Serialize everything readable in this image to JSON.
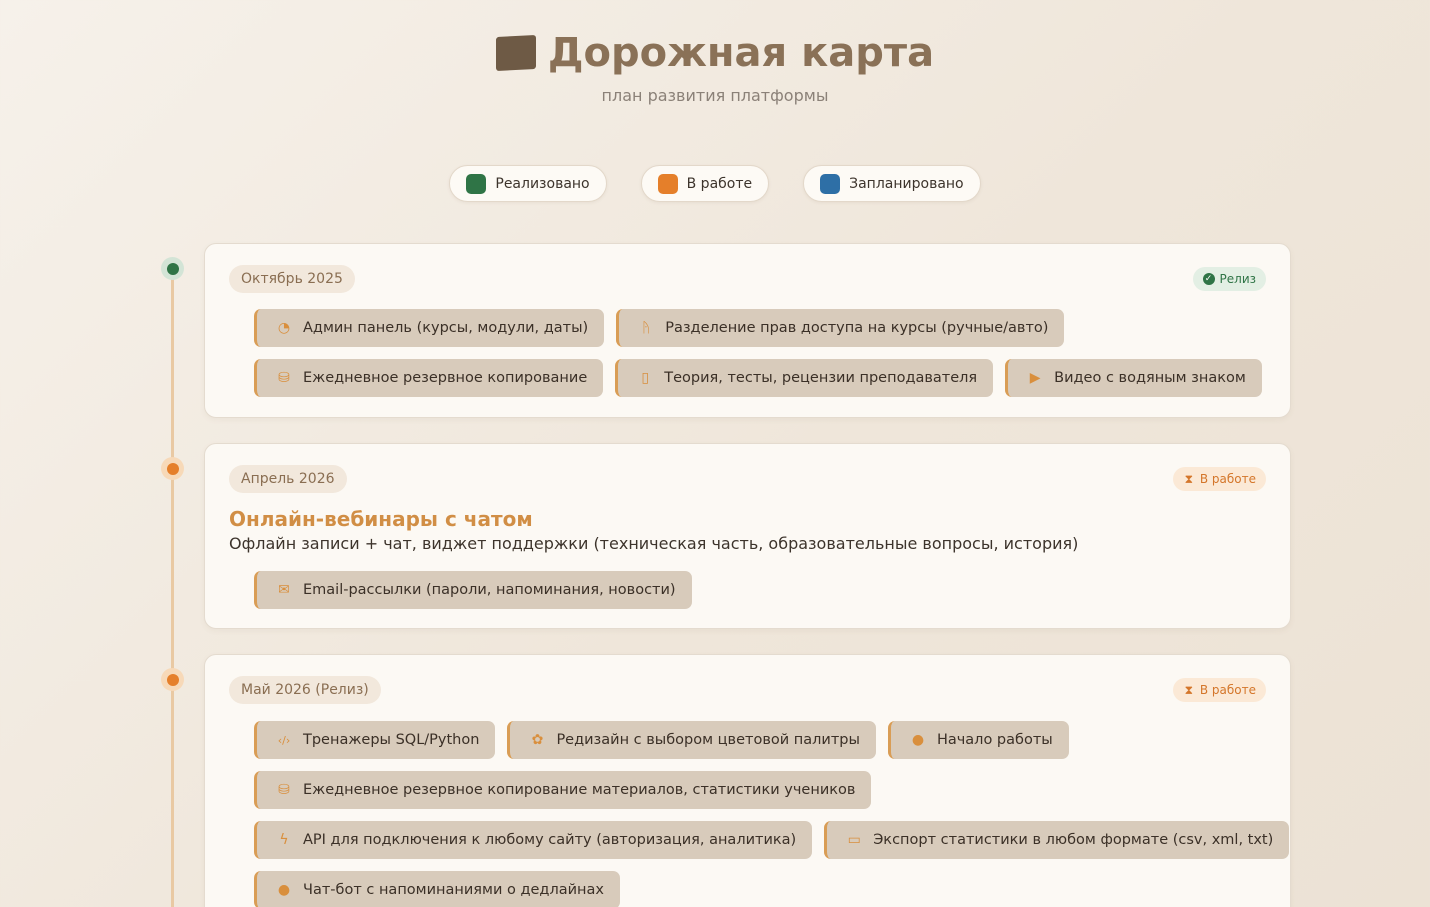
{
  "header": {
    "title": "Дорожная карта",
    "subtitle": "план развития платформы",
    "title_icon": "map-icon"
  },
  "legend": [
    {
      "label": "Реализовано",
      "color": "#2f7446"
    },
    {
      "label": "В работе",
      "color": "#e57f2a"
    },
    {
      "label": "Запланировано",
      "color": "#2e6fa6"
    }
  ],
  "milestones": [
    {
      "date": "Октябрь 2025",
      "status": "Релиз",
      "status_type": "done",
      "rows": [
        [
          {
            "icon": "dashboard-icon",
            "glyph": "◔",
            "label": "Админ панель (курсы, модули, даты)"
          },
          {
            "icon": "person-icon",
            "glyph": "ᚤ",
            "label": "Разделение прав доступа на курсы (ручные/авто)"
          }
        ],
        [
          {
            "icon": "database-icon",
            "glyph": "⛁",
            "label": "Ежедневное резервное копирование"
          },
          {
            "icon": "book-icon",
            "glyph": "▯",
            "label": "Теория, тесты, рецензии преподавателя"
          },
          {
            "icon": "video-icon",
            "glyph": "▶",
            "label": "Видео с водяным знаком"
          }
        ]
      ]
    },
    {
      "date": "Апрель 2026",
      "status": "В работе",
      "status_type": "work",
      "title": "Онлайн-вебинары с чатом",
      "description": "Офлайн записи + чат, виджет поддержки (техническая часть, образовательные вопросы, история)",
      "rows": [
        [
          {
            "icon": "mail-icon",
            "glyph": "✉",
            "label": "Email-рассылки (пароли, напоминания, новости)"
          }
        ]
      ]
    },
    {
      "date": "Май 2026 (Релиз)",
      "status": "В работе",
      "status_type": "work",
      "rows": [
        [
          {
            "icon": "code-icon",
            "glyph": "‹/›",
            "label": "Тренажеры SQL/Python"
          },
          {
            "icon": "palette-icon",
            "glyph": "✿",
            "label": "Редизайн с выбором цветовой палитры"
          },
          {
            "icon": "play-icon",
            "glyph": "●",
            "label": "Начало работы"
          }
        ],
        [
          {
            "icon": "database-icon",
            "glyph": "⛁",
            "label": "Ежедневное резервное копирование материалов, статистики учеников"
          }
        ],
        [
          {
            "icon": "plug-icon",
            "glyph": "ϟ",
            "label": "API для подключения к любому сайту (авторизация, аналитика)"
          },
          {
            "icon": "file-export-icon",
            "glyph": "▭",
            "label": "Экспорт статистики в любом формате (csv, xml, txt)"
          }
        ],
        [
          {
            "icon": "chat-icon",
            "glyph": "●",
            "label": "Чат-бот с напоминаниями о дедлайнах"
          }
        ]
      ]
    }
  ]
}
